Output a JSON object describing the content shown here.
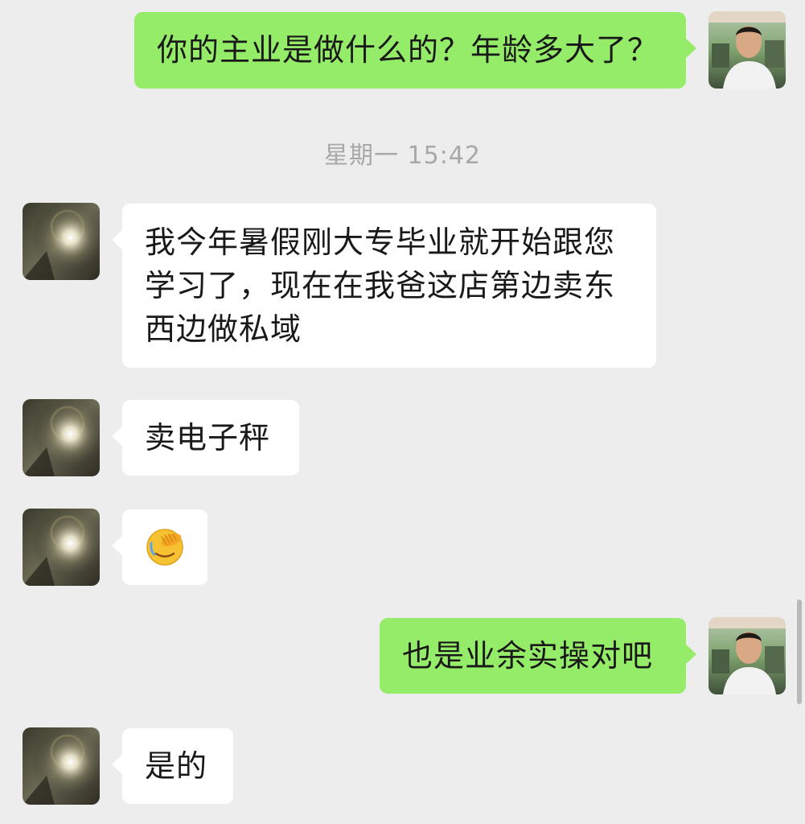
{
  "colors": {
    "background": "#ededed",
    "self_bubble": "#95ec69",
    "peer_bubble": "#ffffff",
    "timestamp_text": "#a8a8a8"
  },
  "timestamp": "星期一 15:42",
  "messages": [
    {
      "sender": "self",
      "text": "你的主业是做什么的？年龄多大了？"
    },
    {
      "sender": "peer",
      "text": "我今年暑假刚大专毕业就开始跟您学习了，现在在我爸这店第边卖东西边做私域"
    },
    {
      "sender": "peer",
      "text": "卖电子秤"
    },
    {
      "sender": "peer",
      "emoji": "facepalm-emoji"
    },
    {
      "sender": "self",
      "text": "也是业余实操对吧"
    },
    {
      "sender": "peer",
      "text": "是的"
    }
  ]
}
